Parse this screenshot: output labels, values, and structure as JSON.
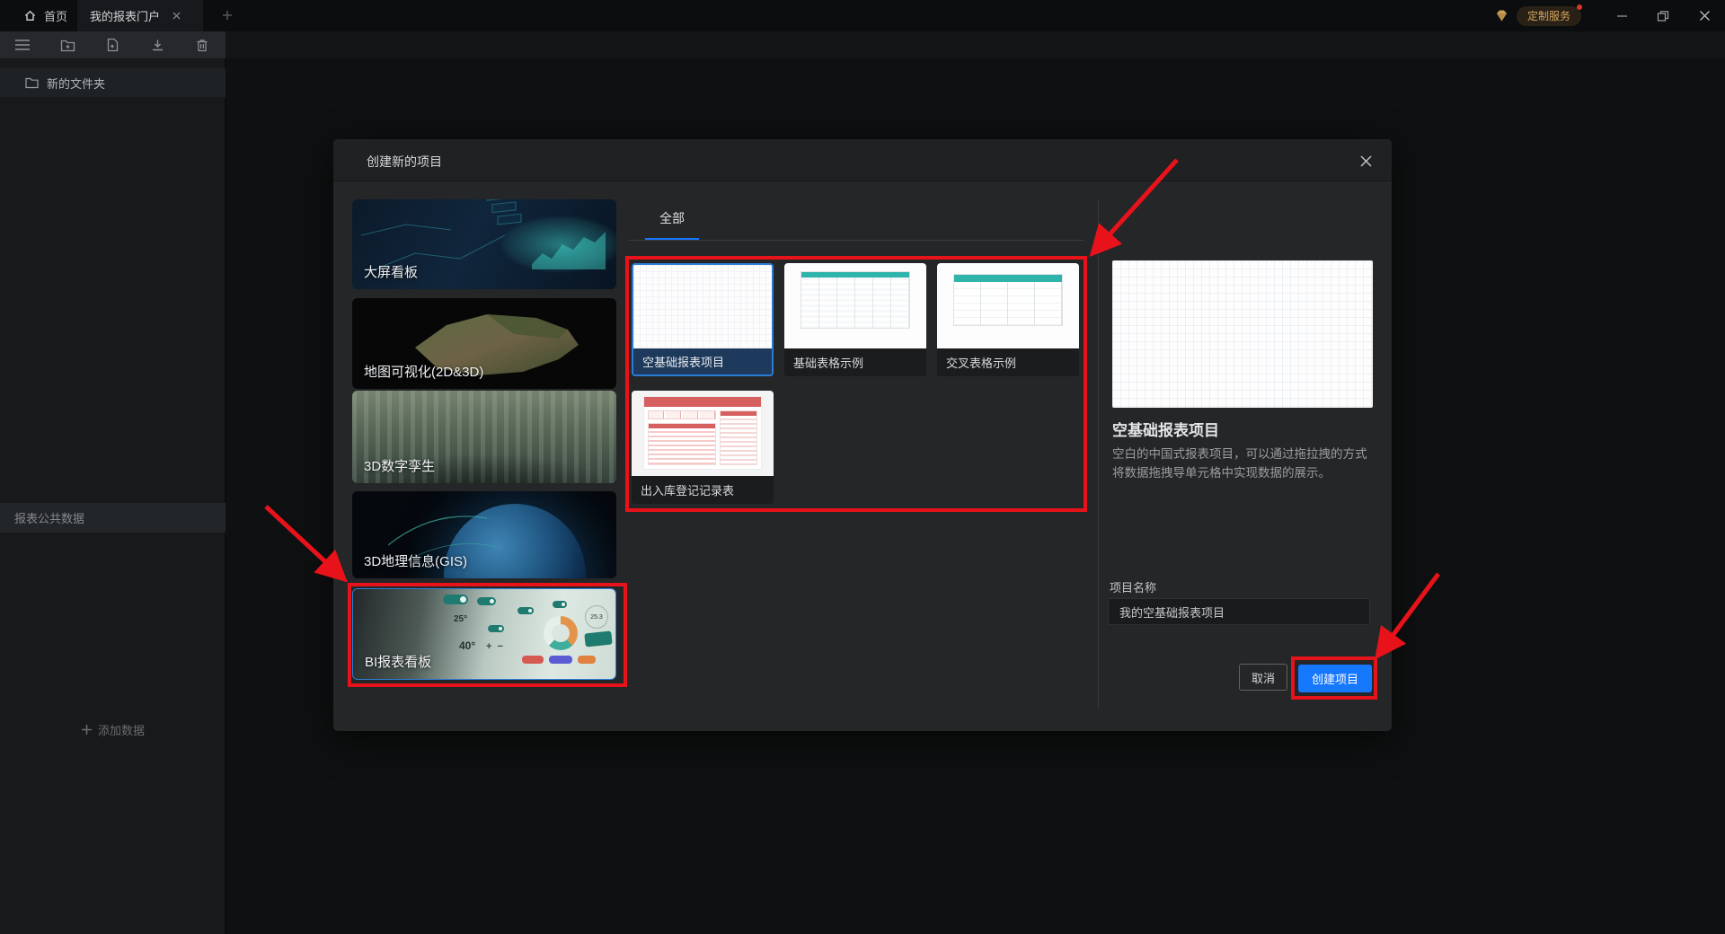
{
  "window": {
    "tabs": [
      {
        "label": "首页"
      },
      {
        "label": "我的报表门户"
      }
    ],
    "badge": {
      "label": "定制服务"
    }
  },
  "sidebar": {
    "folder_item": "新的文件夹",
    "section_public_data": "报表公共数据",
    "add_data": "添加数据"
  },
  "modal": {
    "title": "创建新的项目",
    "tab_all": "全部",
    "categories": [
      {
        "label": "大屏看板"
      },
      {
        "label": "地图可视化(2D&3D)"
      },
      {
        "label": "3D数字孪生"
      },
      {
        "label": "3D地理信息(GIS)"
      },
      {
        "label": "BI报表看板",
        "selected": true
      }
    ],
    "bi_preview": {
      "temp_small": "25°",
      "temp_large": "40°",
      "gauge": "25.3"
    },
    "templates": [
      {
        "label": "空基础报表项目",
        "selected": true
      },
      {
        "label": "基础表格示例"
      },
      {
        "label": "交叉表格示例"
      },
      {
        "label": "出入库登记记录表"
      }
    ],
    "detail": {
      "title": "空基础报表项目",
      "description": "空白的中国式报表项目，可以通过拖拉拽的方式将数据拖拽导单元格中实现数据的展示。",
      "project_name_label": "项目名称",
      "project_name_value": "我的空基础报表项目",
      "cancel_label": "取消",
      "create_label": "创建项目"
    }
  },
  "colors": {
    "accent_blue": "#1677ff",
    "annotation_red": "#e8131a",
    "selected_strip": "#1d3a5c",
    "table_teal": "#2fb3aa",
    "badge_gold": "#d2a55e"
  }
}
